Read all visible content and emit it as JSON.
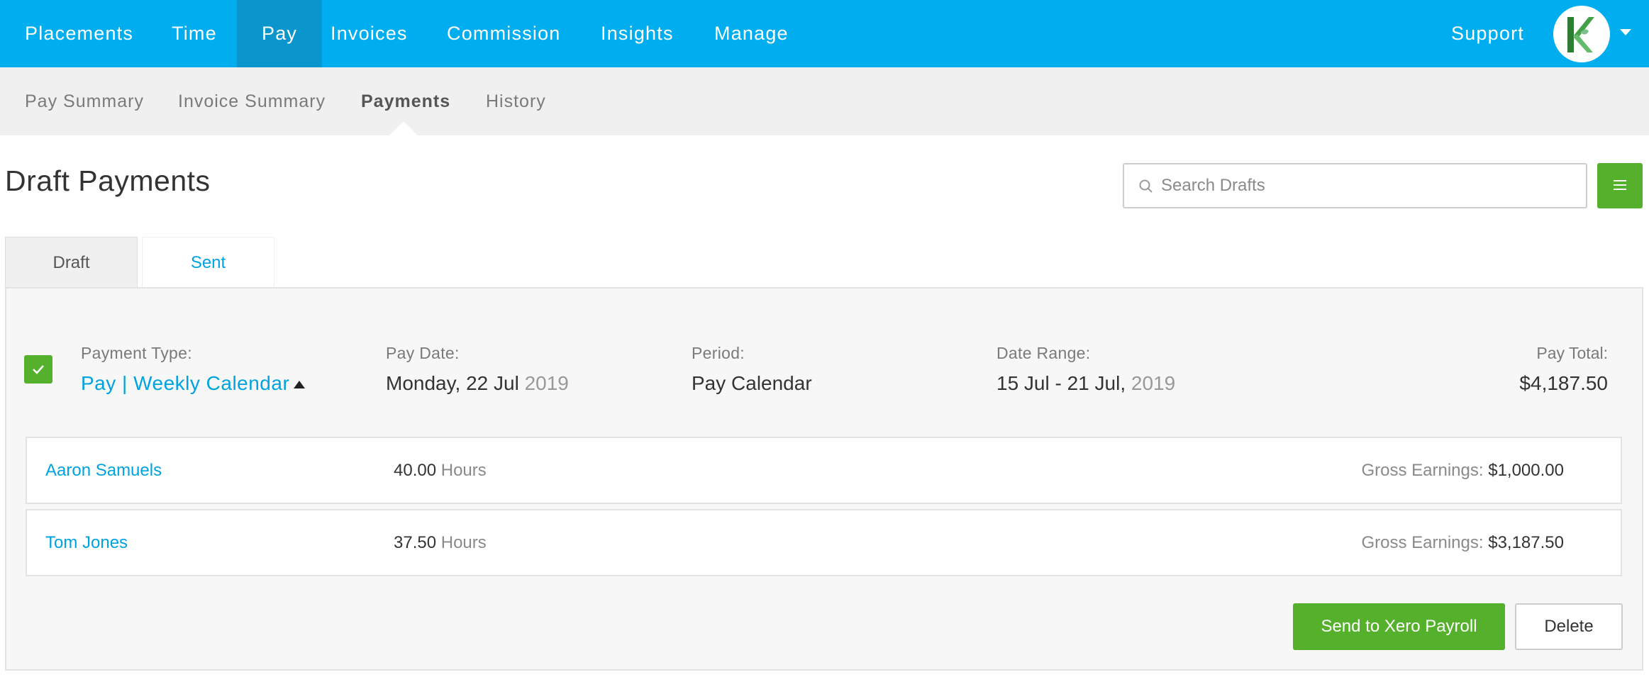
{
  "topnav": {
    "items": [
      "Placements",
      "Time",
      "Pay",
      "Invoices",
      "Commission",
      "Insights",
      "Manage"
    ],
    "active": "Pay",
    "support_label": "Support",
    "brand_color": "#00aeef",
    "active_color": "#0a96cc"
  },
  "subnav": {
    "items": [
      "Pay Summary",
      "Invoice Summary",
      "Payments",
      "History"
    ],
    "active": "Payments"
  },
  "page": {
    "title": "Draft Payments",
    "search_placeholder": "Search Drafts"
  },
  "tabs": {
    "draft": "Draft",
    "sent": "Sent",
    "active": "Draft"
  },
  "payment": {
    "selected": true,
    "type_label": "Payment Type:",
    "type_value": "Pay | Weekly Calendar",
    "pay_date_label": "Pay Date:",
    "pay_date_main": "Monday, 22 Jul",
    "pay_date_year": "2019",
    "period_label": "Period:",
    "period_value": "Pay Calendar",
    "date_range_label": "Date Range:",
    "date_range_main": "15 Jul - 21 Jul,",
    "date_range_year": "2019",
    "pay_total_label": "Pay Total:",
    "pay_total_value": "$4,187.50"
  },
  "rows": [
    {
      "name": "Aaron Samuels",
      "hours": "40.00",
      "hours_unit": "Hours",
      "gross_label": "Gross Earnings:",
      "gross_value": "$1,000.00"
    },
    {
      "name": "Tom Jones",
      "hours": "37.50",
      "hours_unit": "Hours",
      "gross_label": "Gross Earnings:",
      "gross_value": "$3,187.50"
    }
  ],
  "actions": {
    "send_label": "Send to Xero Payroll",
    "delete_label": "Delete"
  },
  "colors": {
    "accent_green": "#55b12c",
    "link_blue": "#00a3e0"
  },
  "icons": {
    "search": "search-icon",
    "menu": "hamburger-menu-icon",
    "check": "checkmark-icon",
    "caret_up": "caret-up-icon",
    "caret_down": "caret-down-icon",
    "logo": "brand-logo-icon"
  }
}
